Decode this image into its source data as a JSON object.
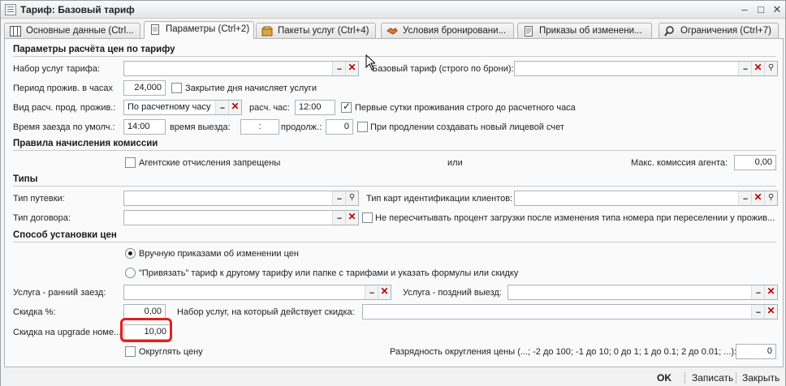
{
  "window": {
    "title": "Тариф: Базовый тариф",
    "min": "‒",
    "max": "□",
    "close": "✕"
  },
  "tabs": [
    "Основные данные (Ctrl...",
    "Параметры (Ctrl+2)",
    "Пакеты услуг (Ctrl+4)",
    "Условия бронировани...",
    "Приказы об изменени...",
    "Ограничения (Ctrl+7)"
  ],
  "sections": {
    "s1": "Параметры расчёта цен по тарифу",
    "s2": "Правила начисления комиссии",
    "s3": "Типы",
    "s4": "Способ установки цен"
  },
  "fields": {
    "services_label": "Набор услуг тарифа:",
    "services_value": "",
    "base_label": "Базовый тариф (строго по брони):",
    "base_value": "",
    "period_label": "Период прожив. в часах",
    "period_value": "24,000",
    "close_day_label": "Закрытие дня начисляет услуги",
    "calc_kind_label": "Вид расч. прод. прожив.:",
    "calc_kind_value": "По расчетному часу",
    "calc_hour_label": "расч. час:",
    "calc_hour_value": "12:00",
    "first_day_label": "Первые сутки проживания строго до расчетного часа",
    "checkin_label": "Время заезда по умолч.:",
    "checkin_value": "14:00",
    "checkout_label": "время выезда:",
    "checkout_value": ":",
    "ext_label": "продолж.:",
    "ext_value": "0",
    "new_account_label": "При продлении создавать новый лицевой счет",
    "agent_label": "Агентские отчисления запрещены",
    "or_label": "или",
    "max_comm_label": "Макс. комиссия агента:",
    "max_comm_value": "0,00",
    "trip_label": "Тип путевки:",
    "trip_value": "",
    "card_label": "Тип карт идентификации клиентов:",
    "card_value": "",
    "contract_label": "Тип договора:",
    "contract_value": "",
    "no_recalc_label": "Не пересчитывать процент загрузки после изменения типа номера при переселении у прожив...",
    "radio1_label": "Вручную приказами об изменении цен",
    "radio2_label": "\"Привязать\" тариф к другому тарифу или папке с тарифами и указать формулы или скидку",
    "early_label": "Услуга - ранний заезд:",
    "early_value": "",
    "late_label": "Услуга - поздний выезд:",
    "late_value": "",
    "discount_label": "Скидка %:",
    "discount_value": "0,00",
    "disc_services_label": "Набор услуг, на который действует скидка:",
    "disc_services_value": "",
    "upgrade_label": "Скидка на upgrade номе...",
    "upgrade_value": "10,00",
    "round_label": "Округлять цену",
    "round_digits_label": "Разрядность округления цены (...; -2 до 100; -1 до 10; 0 до 1; 1 до 0.1; 2 до 0.01; ...):",
    "round_digits_value": "0"
  },
  "buttons": {
    "ok": "OK",
    "save": "Записать",
    "close": "Закрыть"
  },
  "icons": {
    "dots": "...",
    "clear": "✕",
    "search": "⚲"
  }
}
